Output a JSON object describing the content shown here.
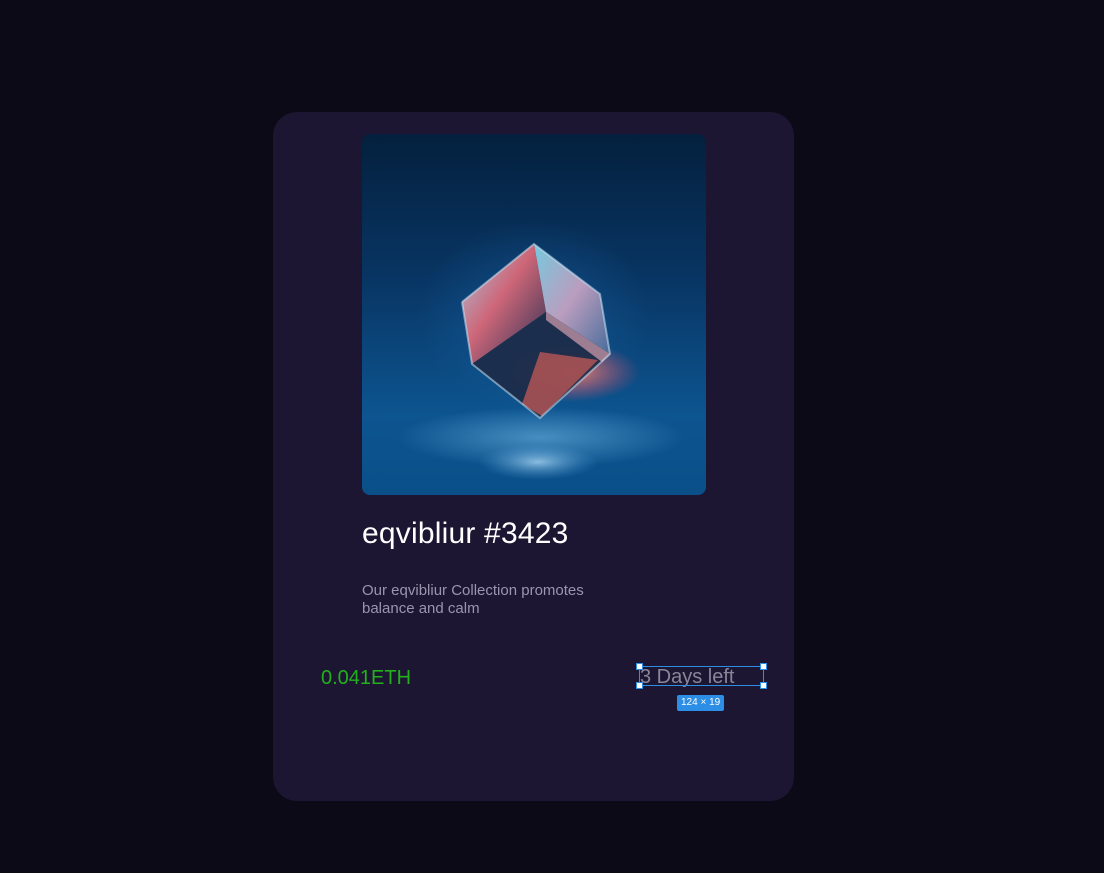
{
  "card": {
    "artwork_subject": "glass-cube-icon",
    "title": "eqvibliur #3423",
    "description": "Our eqvibliur Collection promotes balance and calm",
    "price": "0.041ETH",
    "time_left": "3 Days left"
  },
  "selection": {
    "size_label": "124 × 19"
  },
  "colors": {
    "page_background": "#0b0a16",
    "card_background": "#1c1633",
    "price": "#22b01b",
    "time_left": "#8a8699",
    "selection_accent": "#2d8ee6"
  }
}
